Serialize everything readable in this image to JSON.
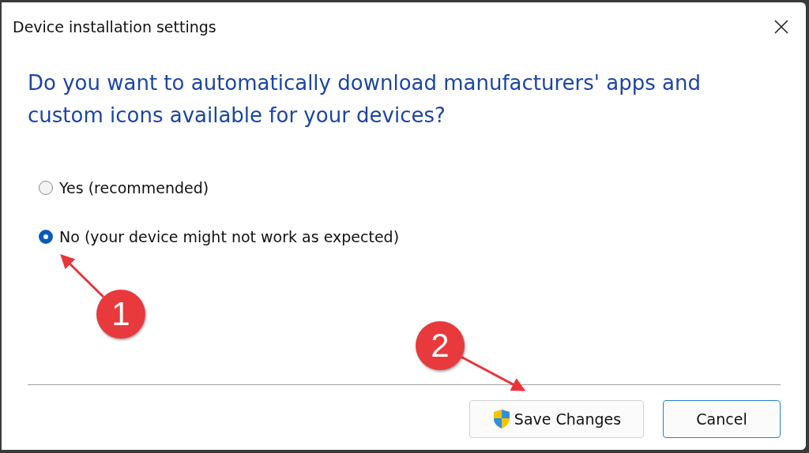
{
  "window": {
    "title": "Device installation settings"
  },
  "question": "Do you want to automatically download manufacturers' apps and custom icons available for your devices?",
  "options": [
    {
      "label": "Yes (recommended)",
      "selected": false
    },
    {
      "label": "No (your device might not work as expected)",
      "selected": true
    }
  ],
  "buttons": [
    {
      "label": "Save Changes",
      "kind": "shield",
      "focused": false
    },
    {
      "label": "Cancel",
      "kind": "plain",
      "focused": true
    }
  ],
  "annotations": [
    {
      "label": "1",
      "kind": "option"
    },
    {
      "label": "2",
      "kind": "button"
    }
  ]
}
